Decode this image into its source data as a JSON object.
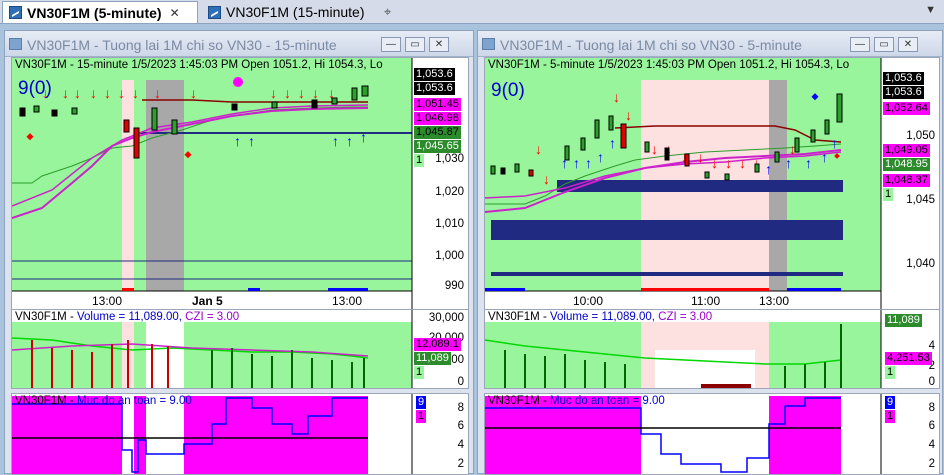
{
  "tabs": [
    {
      "label": "VN30F1M (5-minute)",
      "close": "✕",
      "active": true
    },
    {
      "label": "VN30F1M (15-minute)",
      "active": false
    }
  ],
  "tab_pin_glyph": "⌖",
  "tab_scroll_glyph": "▼",
  "window_buttons": {
    "minimize": "—",
    "restore": "▭",
    "close": "✕"
  },
  "left": {
    "title": "VN30F1M - Tuong lai 1M chi so VN30 - 15-minute",
    "header": "VN30F1M - 15-minute 1/5/2023 1:45:03 PM Open 1051.2, Hi 1054.3, Lo",
    "signal": "9(0)",
    "price_ticks": [
      "1,030",
      "1,020",
      "1,010",
      "1,000",
      "990"
    ],
    "price_tags": [
      "1,053.6",
      "1,053.6",
      "1,051.45",
      "1,046.98",
      "1,045.87",
      "1,045.65",
      "1"
    ],
    "x_labels": [
      "13:00",
      "Jan 5",
      "13:00"
    ],
    "volume_header": {
      "name": "VN30F1M - ",
      "volume": "Volume = 11,089.00,",
      "czi": " CZI = 3.00"
    },
    "volume_ticks": [
      "30,000",
      "20,000",
      "10,000",
      "0"
    ],
    "volume_tags": [
      "12,089.1",
      "11,089",
      "1"
    ],
    "safety_header": {
      "name": "VN30F1M - ",
      "label": "Muc do an toan = 9.00"
    },
    "safety_ticks": [
      "8",
      "6",
      "4",
      "2"
    ],
    "safety_tags": [
      "9",
      "1"
    ]
  },
  "right": {
    "title": "VN30F1M - Tuong lai 1M chi so VN30 - 5-minute",
    "header": "VN30F1M - 5-minute 1/5/2023 1:45:03 PM Open 1051.2, Hi 1054.3, Lo",
    "signal": "9(0)",
    "price_ticks": [
      "1,050",
      "1,045",
      "1,040"
    ],
    "price_tags": [
      "1,053.6",
      "1,053.6",
      "1,052.64",
      "1,049.05",
      "1,048.95",
      "1,048.37",
      "1"
    ],
    "x_labels": [
      "10:00",
      "11:00",
      "13:00"
    ],
    "volume_header": {
      "name": "VN30F1M - ",
      "volume": "Volume = 11,089.00,",
      "czi": " CZI = 3.00"
    },
    "volume_ticks": [
      "4",
      "2",
      "0"
    ],
    "volume_tags": [
      "11,089",
      "4,251.53",
      "1"
    ],
    "safety_header": {
      "name": "VN30F1M - ",
      "label": "Muc do an toan = 9.00"
    },
    "safety_ticks": [
      "8",
      "6",
      "4",
      "2"
    ],
    "safety_tags": [
      "9",
      "1"
    ]
  },
  "colors": {
    "bg_green": "#99f59b",
    "gray_band": "#a8a8a8",
    "pink_band": "#fde0e0",
    "magenta": "#ff00ff",
    "navy": "#1f2a80",
    "up_arrow": "#0000ff",
    "down_arrow": "#ff0000"
  }
}
